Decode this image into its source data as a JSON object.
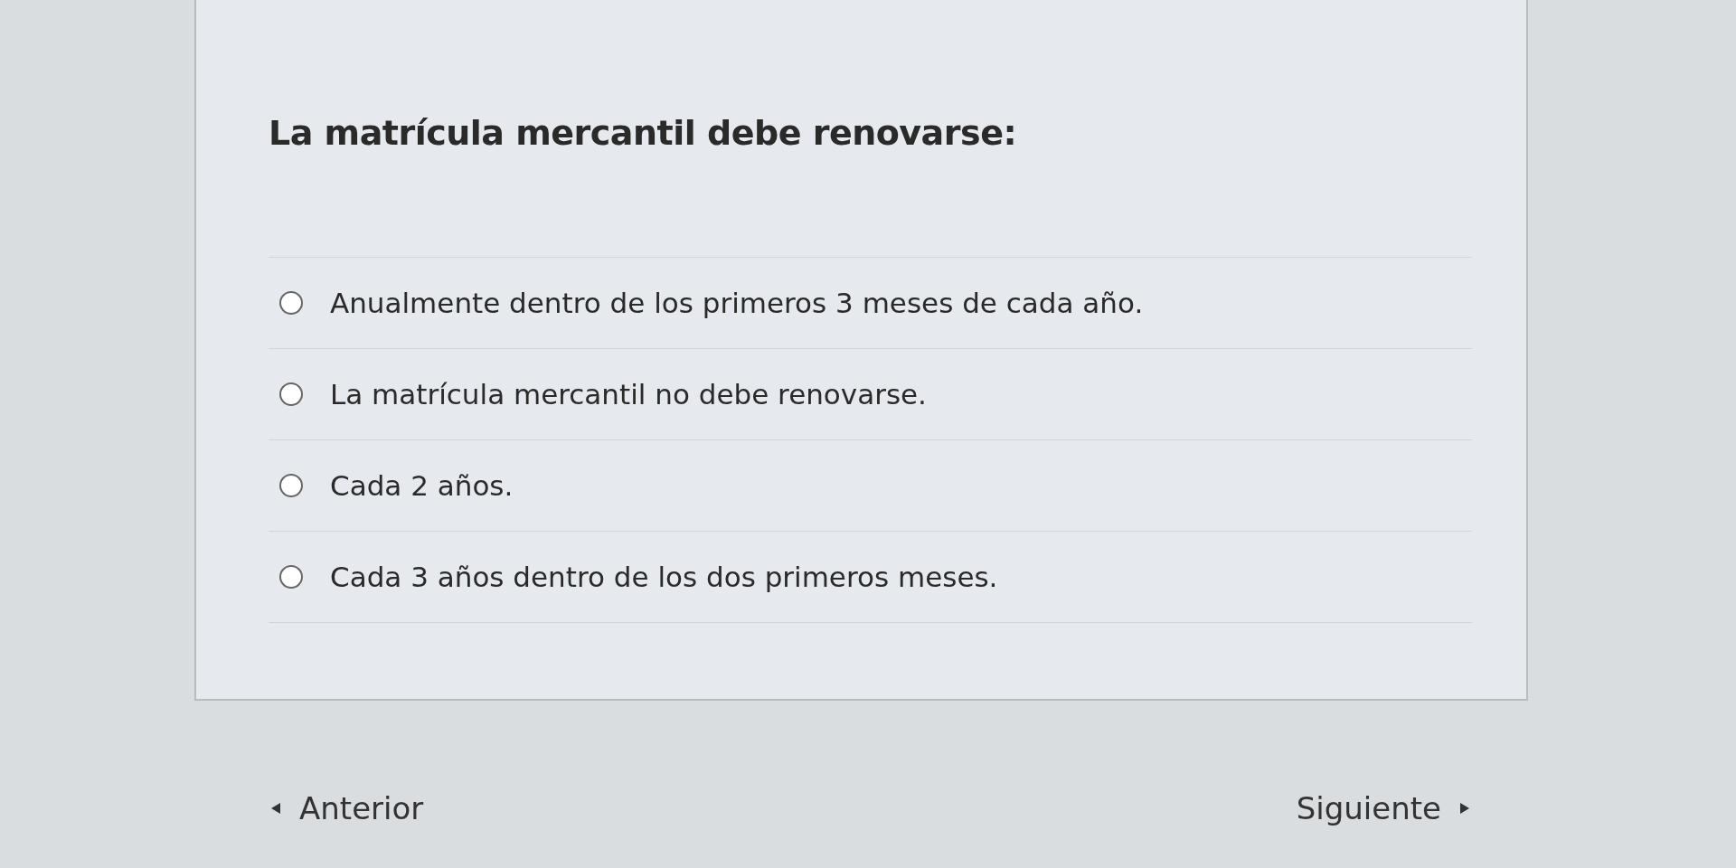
{
  "question": {
    "text": "La matrícula mercantil debe renovarse:",
    "options": [
      {
        "label": "Anualmente dentro de los primeros 3 meses de cada año.",
        "selected": false
      },
      {
        "label": "La matrícula mercantil no debe renovarse.",
        "selected": false
      },
      {
        "label": "Cada 2 años.",
        "selected": false
      },
      {
        "label": "Cada 3 años dentro de los dos primeros meses.",
        "selected": false
      }
    ]
  },
  "navigation": {
    "previous": "Anterior",
    "next": "Siguiente"
  }
}
